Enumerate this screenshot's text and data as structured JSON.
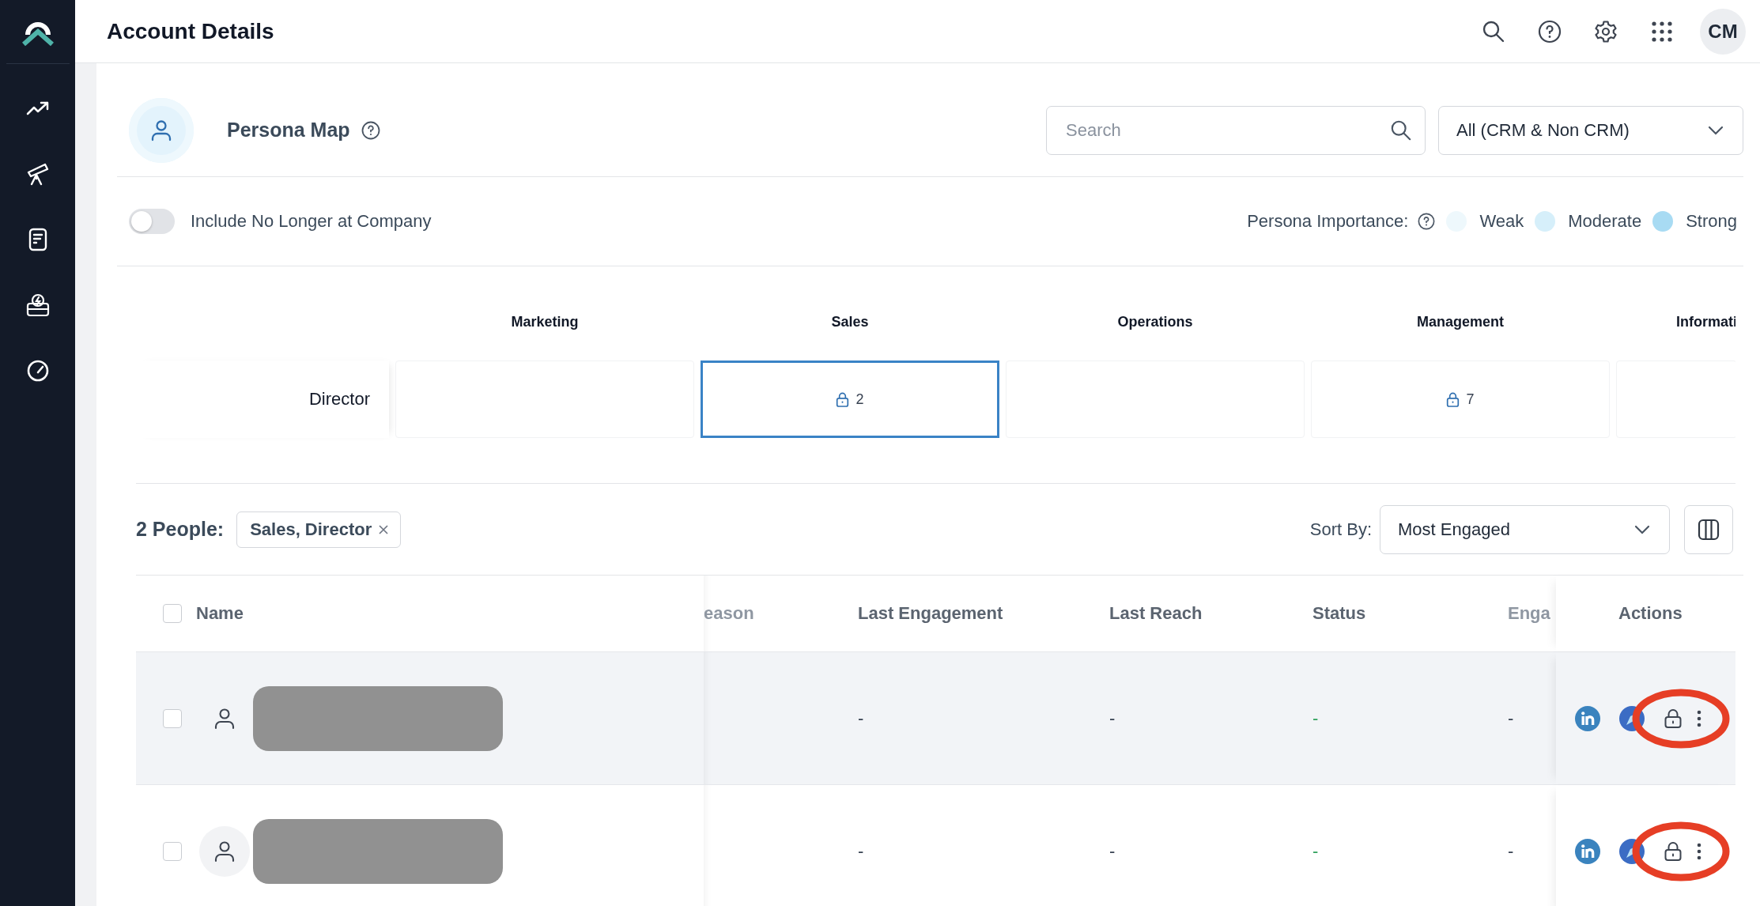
{
  "header": {
    "title": "Account Details",
    "user_initials": "CM"
  },
  "persona_map": {
    "title": "Persona Map",
    "search": {
      "placeholder": "Search"
    },
    "filter": {
      "value": "All (CRM & Non CRM)"
    },
    "toggle": {
      "label": "Include No Longer at Company",
      "on": false
    },
    "importance": {
      "label": "Persona Importance:",
      "levels": [
        {
          "label": "Weak",
          "color": "#eef8fc"
        },
        {
          "label": "Moderate",
          "color": "#d6effa"
        },
        {
          "label": "Strong",
          "color": "#a8dbf3"
        }
      ]
    },
    "grid": {
      "columns": [
        "Marketing",
        "Sales",
        "Operations",
        "Management",
        "Informati"
      ],
      "rows": [
        {
          "label": "Director",
          "cells": [
            {
              "locked": false,
              "selected": false
            },
            {
              "locked": true,
              "count": "2",
              "selected": true
            },
            {
              "locked": false,
              "selected": false
            },
            {
              "locked": true,
              "count": "7",
              "selected": false
            },
            {
              "locked": false,
              "selected": false
            }
          ]
        }
      ]
    }
  },
  "people": {
    "count_label": "2 People:",
    "filter_chip": "Sales, Director",
    "sort": {
      "label": "Sort By:",
      "value": "Most Engaged"
    }
  },
  "table": {
    "select_all_checked": false,
    "columns": [
      "Name",
      "eason",
      "Last Engagement",
      "Last Reach",
      "Status",
      "Enga",
      "Actions"
    ],
    "rows": [
      {
        "checked": false,
        "hovered": true,
        "avatar_highlighted": false,
        "name_redacted": true,
        "last_engagement": "-",
        "last_reach": "-",
        "status": "-",
        "engagement": "-",
        "action_circled": true
      },
      {
        "checked": false,
        "hovered": false,
        "avatar_highlighted": true,
        "name_redacted": true,
        "last_engagement": "-",
        "last_reach": "-",
        "status": "-",
        "engagement": "-",
        "action_circled": true
      }
    ]
  }
}
